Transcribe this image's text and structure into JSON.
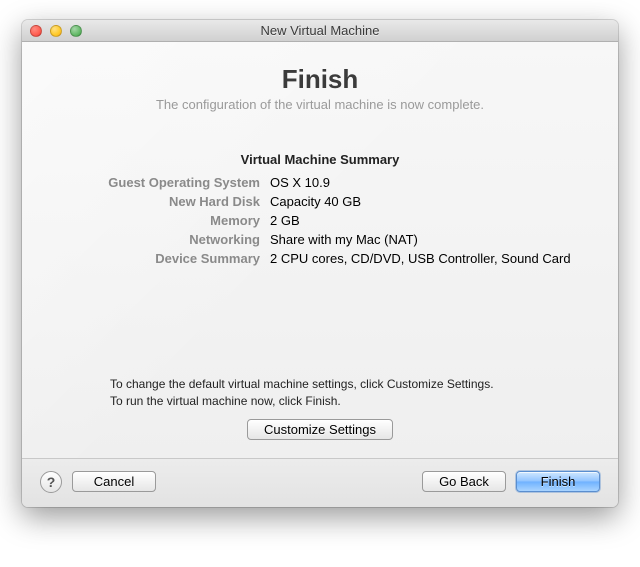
{
  "window": {
    "title": "New Virtual Machine"
  },
  "header": {
    "title": "Finish",
    "subtitle": "The configuration of the virtual machine is now complete."
  },
  "summary": {
    "title": "Virtual Machine Summary",
    "rows": [
      {
        "label": "Guest Operating System",
        "value": "OS X 10.9"
      },
      {
        "label": "New Hard Disk",
        "value": "Capacity 40 GB"
      },
      {
        "label": "Memory",
        "value": "2 GB"
      },
      {
        "label": "Networking",
        "value": "Share with my Mac (NAT)"
      },
      {
        "label": "Device Summary",
        "value": "2 CPU cores, CD/DVD, USB Controller, Sound Card"
      }
    ]
  },
  "instructions": {
    "line1": "To change the default virtual machine settings, click Customize Settings.",
    "line2": "To run the virtual machine now, click Finish."
  },
  "buttons": {
    "customize": "Customize Settings",
    "help": "?",
    "cancel": "Cancel",
    "back": "Go Back",
    "finish": "Finish"
  }
}
